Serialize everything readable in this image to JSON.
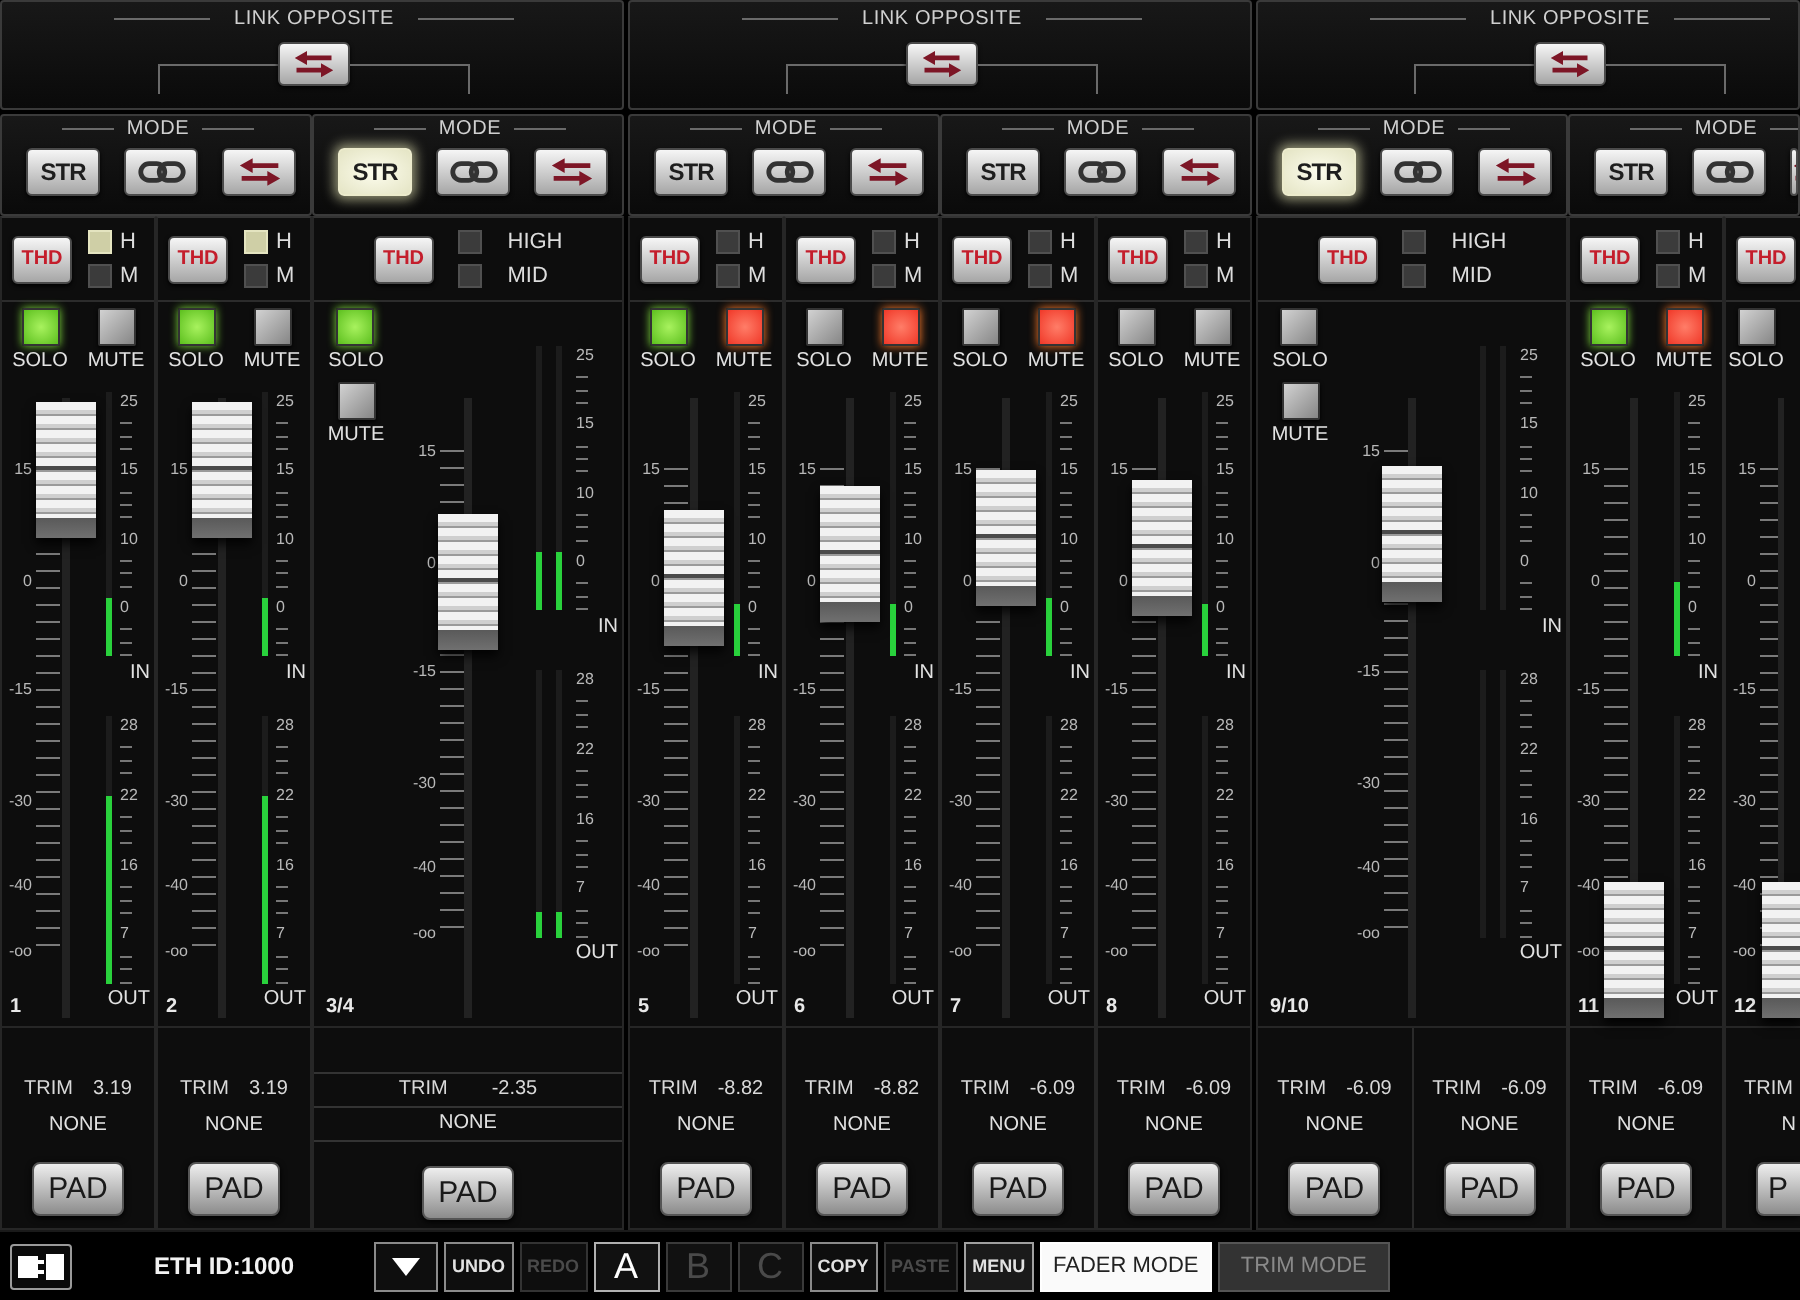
{
  "groups": [
    {
      "title": "LINK OPPOSITE",
      "modes": [
        {
          "title": "MODE",
          "buttons": [
            {
              "kind": "str",
              "label": "STR",
              "selected": false
            },
            {
              "kind": "link",
              "selected": false
            },
            {
              "kind": "swap",
              "selected": false
            }
          ],
          "channels": [
            {
              "kind": "mono",
              "thd": "THD",
              "bands": [
                {
                  "label": "H",
                  "on": true
                },
                {
                  "label": "M",
                  "on": false
                }
              ],
              "solo": {
                "label": "SOLO",
                "on": true
              },
              "mute": {
                "label": "MUTE",
                "on": false
              },
              "fader_scale": [
                "15",
                "0",
                "-15",
                "-30",
                "-40",
                "-oo"
              ],
              "fader": {
                "level": 0.99
              },
              "in_scale": [
                "25",
                "15",
                "10",
                "0"
              ],
              "in_label": "IN",
              "in_meters": [
                {
                  "level": 0.22
                }
              ],
              "out_scale": [
                "28",
                "22",
                "16",
                "7"
              ],
              "out_label": "OUT",
              "out_meters": [
                {
                  "level": 0.7
                }
              ],
              "number": "1",
              "trims": [
                {
                  "label": "TRIM",
                  "value": "3.19",
                  "source": "NONE",
                  "pad": "PAD"
                }
              ]
            },
            {
              "kind": "mono",
              "thd": "THD",
              "bands": [
                {
                  "label": "H",
                  "on": true
                },
                {
                  "label": "M",
                  "on": false
                }
              ],
              "solo": {
                "label": "SOLO",
                "on": true
              },
              "mute": {
                "label": "MUTE",
                "on": false
              },
              "fader_scale": [
                "15",
                "0",
                "-15",
                "-30",
                "-40",
                "-oo"
              ],
              "fader": {
                "level": 0.99
              },
              "in_scale": [
                "25",
                "15",
                "10",
                "0"
              ],
              "in_label": "IN",
              "in_meters": [
                {
                  "level": 0.22
                }
              ],
              "out_scale": [
                "28",
                "22",
                "16",
                "7"
              ],
              "out_label": "OUT",
              "out_meters": [
                {
                  "level": 0.7
                }
              ],
              "number": "2",
              "trims": [
                {
                  "label": "TRIM",
                  "value": "3.19",
                  "source": "NONE",
                  "pad": "PAD"
                }
              ]
            }
          ]
        },
        {
          "title": "MODE",
          "buttons": [
            {
              "kind": "str",
              "label": "STR",
              "selected": true
            },
            {
              "kind": "link",
              "selected": false
            },
            {
              "kind": "swap",
              "selected": false
            }
          ],
          "channels": [
            {
              "kind": "stereo",
              "thd": "THD",
              "bands": [
                {
                  "label": "HIGH",
                  "on": false
                },
                {
                  "label": "MID",
                  "on": false
                }
              ],
              "solo": {
                "label": "SOLO",
                "on": true
              },
              "mute": {
                "label": "MUTE",
                "on": false
              },
              "fader_scale": [
                "15",
                "0",
                "-15",
                "-30",
                "-40",
                "-oo"
              ],
              "fader": {
                "level": 0.76
              },
              "in_scale": [
                "25",
                "15",
                "10",
                "0"
              ],
              "in_label": "IN",
              "in_meters": [
                {
                  "level": 0.22
                },
                {
                  "level": 0.22
                }
              ],
              "out_scale": [
                "28",
                "22",
                "16",
                "7"
              ],
              "out_label": "OUT",
              "out_meters": [
                {
                  "level": 0.1
                },
                {
                  "level": 0.1
                }
              ],
              "number": "3/4",
              "trims": [
                {
                  "label": "TRIM",
                  "value": "-2.35",
                  "source": "NONE",
                  "pad": "PAD"
                }
              ]
            }
          ]
        }
      ]
    },
    {
      "title": "LINK OPPOSITE",
      "modes": [
        {
          "title": "MODE",
          "buttons": [
            {
              "kind": "str",
              "label": "STR",
              "selected": false
            },
            {
              "kind": "link",
              "selected": false
            },
            {
              "kind": "swap",
              "selected": false
            }
          ],
          "channels": [
            {
              "kind": "mono",
              "thd": "THD",
              "bands": [
                {
                  "label": "H",
                  "on": false
                },
                {
                  "label": "M",
                  "on": false
                }
              ],
              "solo": {
                "label": "SOLO",
                "on": true
              },
              "mute": {
                "label": "MUTE",
                "on": true
              },
              "fader_scale": [
                "15",
                "0",
                "-15",
                "-30",
                "-40",
                "-oo"
              ],
              "fader": {
                "level": 0.77
              },
              "in_scale": [
                "25",
                "15",
                "10",
                "0"
              ],
              "in_label": "IN",
              "in_meters": [
                {
                  "level": 0.2
                }
              ],
              "out_scale": [
                "28",
                "22",
                "16",
                "7"
              ],
              "out_label": "OUT",
              "number": "5",
              "trims": [
                {
                  "label": "TRIM",
                  "value": "-8.82",
                  "source": "NONE",
                  "pad": "PAD"
                }
              ]
            },
            {
              "kind": "mono",
              "thd": "THD",
              "bands": [
                {
                  "label": "H",
                  "on": false
                },
                {
                  "label": "M",
                  "on": false
                }
              ],
              "solo": {
                "label": "SOLO",
                "on": false
              },
              "mute": {
                "label": "MUTE",
                "on": true
              },
              "fader_scale": [
                "15",
                "0",
                "-15",
                "-30",
                "-40",
                "-oo"
              ],
              "fader": {
                "level": 0.82
              },
              "in_scale": [
                "25",
                "15",
                "10",
                "0"
              ],
              "in_label": "IN",
              "in_meters": [
                {
                  "level": 0.2
                }
              ],
              "out_scale": [
                "28",
                "22",
                "16",
                "7"
              ],
              "out_label": "OUT",
              "number": "6",
              "trims": [
                {
                  "label": "TRIM",
                  "value": "-8.82",
                  "source": "NONE",
                  "pad": "PAD"
                }
              ]
            }
          ]
        },
        {
          "title": "MODE",
          "buttons": [
            {
              "kind": "str",
              "label": "STR",
              "selected": false
            },
            {
              "kind": "link",
              "selected": false
            },
            {
              "kind": "swap",
              "selected": false
            }
          ],
          "channels": [
            {
              "kind": "mono",
              "thd": "THD",
              "bands": [
                {
                  "label": "H",
                  "on": false
                },
                {
                  "label": "M",
                  "on": false
                }
              ],
              "solo": {
                "label": "SOLO",
                "on": false
              },
              "mute": {
                "label": "MUTE",
                "on": true
              },
              "fader_scale": [
                "15",
                "0",
                "-15",
                "-30",
                "-40",
                "-oo"
              ],
              "fader": {
                "level": 0.85
              },
              "in_scale": [
                "25",
                "15",
                "10",
                "0"
              ],
              "in_label": "IN",
              "in_meters": [
                {
                  "level": 0.22
                }
              ],
              "out_scale": [
                "28",
                "22",
                "16",
                "7"
              ],
              "out_label": "OUT",
              "number": "7",
              "trims": [
                {
                  "label": "TRIM",
                  "value": "-6.09",
                  "source": "NONE",
                  "pad": "PAD"
                }
              ]
            },
            {
              "kind": "mono",
              "thd": "THD",
              "bands": [
                {
                  "label": "H",
                  "on": false
                },
                {
                  "label": "M",
                  "on": false
                }
              ],
              "solo": {
                "label": "SOLO",
                "on": false
              },
              "mute": {
                "label": "MUTE",
                "on": false
              },
              "fader_scale": [
                "15",
                "0",
                "-15",
                "-30",
                "-40",
                "-oo"
              ],
              "fader": {
                "level": 0.83
              },
              "in_scale": [
                "25",
                "15",
                "10",
                "0"
              ],
              "in_label": "IN",
              "in_meters": [
                {
                  "level": 0.2
                }
              ],
              "out_scale": [
                "28",
                "22",
                "16",
                "7"
              ],
              "out_label": "OUT",
              "number": "8",
              "trims": [
                {
                  "label": "TRIM",
                  "value": "-6.09",
                  "source": "NONE",
                  "pad": "PAD"
                }
              ]
            }
          ]
        }
      ]
    },
    {
      "title": "LINK OPPOSITE",
      "modes": [
        {
          "title": "MODE",
          "buttons": [
            {
              "kind": "str",
              "label": "STR",
              "selected": true
            },
            {
              "kind": "link",
              "selected": false
            },
            {
              "kind": "swap",
              "selected": false
            }
          ],
          "channels": [
            {
              "kind": "stereo",
              "thd": "THD",
              "bands": [
                {
                  "label": "HIGH",
                  "on": false
                },
                {
                  "label": "MID",
                  "on": false
                }
              ],
              "solo": {
                "label": "SOLO",
                "on": false
              },
              "mute": {
                "label": "MUTE",
                "on": false
              },
              "fader_scale": [
                "15",
                "0",
                "-15",
                "-30",
                "-40",
                "-oo"
              ],
              "fader": {
                "level": 0.86
              },
              "in_scale": [
                "25",
                "15",
                "10",
                "0"
              ],
              "in_label": "IN",
              "out_scale": [
                "28",
                "22",
                "16",
                "7"
              ],
              "out_label": "OUT",
              "number": "9/10",
              "trims": [
                {
                  "label": "TRIM",
                  "value": "-6.09",
                  "source": "NONE",
                  "pad": "PAD"
                },
                {
                  "label": "TRIM",
                  "value": "-6.09",
                  "source": "NONE",
                  "pad": "PAD"
                }
              ]
            }
          ]
        },
        {
          "title": "MODE",
          "buttons": [
            {
              "kind": "str",
              "label": "STR",
              "selected": false
            },
            {
              "kind": "link",
              "selected": false
            },
            {
              "kind": "swap",
              "selected": false
            }
          ],
          "channels": [
            {
              "kind": "mono",
              "thd": "THD",
              "bands": [
                {
                  "label": "H",
                  "on": false
                },
                {
                  "label": "M",
                  "on": false
                }
              ],
              "solo": {
                "label": "SOLO",
                "on": true
              },
              "mute": {
                "label": "MUTE",
                "on": true
              },
              "fader_scale": [
                "15",
                "0",
                "-15",
                "-30",
                "-40",
                "-oo"
              ],
              "fader": {
                "level": 0
              },
              "in_scale": [
                "25",
                "15",
                "10",
                "0"
              ],
              "in_label": "IN",
              "in_meters": [
                {
                  "level": 0.28
                }
              ],
              "out_scale": [
                "28",
                "22",
                "16",
                "7"
              ],
              "out_label": "OUT",
              "number": "11",
              "trims": [
                {
                  "label": "TRIM",
                  "value": "-6.09",
                  "source": "NONE",
                  "pad": "PAD"
                }
              ]
            },
            {
              "kind": "partial",
              "thd": "THD",
              "solo": {
                "label": "SOLO",
                "on": false
              },
              "fader_scale": [
                "15",
                "0",
                "-15",
                "-30",
                "-40",
                "-oo"
              ],
              "fader": {
                "level": 0
              },
              "number": "12",
              "trims": [
                {
                  "label": "TRIM",
                  "source": "N",
                  "pad": "P"
                }
              ]
            }
          ]
        }
      ]
    }
  ],
  "toolbar": {
    "eth_id": "ETH ID:1000",
    "history": [
      {
        "label": "UNDO",
        "disabled": false
      },
      {
        "label": "REDO",
        "disabled": true
      }
    ],
    "scenes": [
      {
        "label": "A",
        "selected": true
      },
      {
        "label": "B",
        "selected": false
      },
      {
        "label": "C",
        "selected": false
      }
    ],
    "clipboard": [
      {
        "label": "COPY",
        "disabled": false
      },
      {
        "label": "PASTE",
        "disabled": true
      }
    ],
    "menu": "MENU",
    "views": [
      {
        "label": "FADER MODE",
        "selected": true
      },
      {
        "label": "TRIM MODE",
        "selected": false
      }
    ]
  }
}
